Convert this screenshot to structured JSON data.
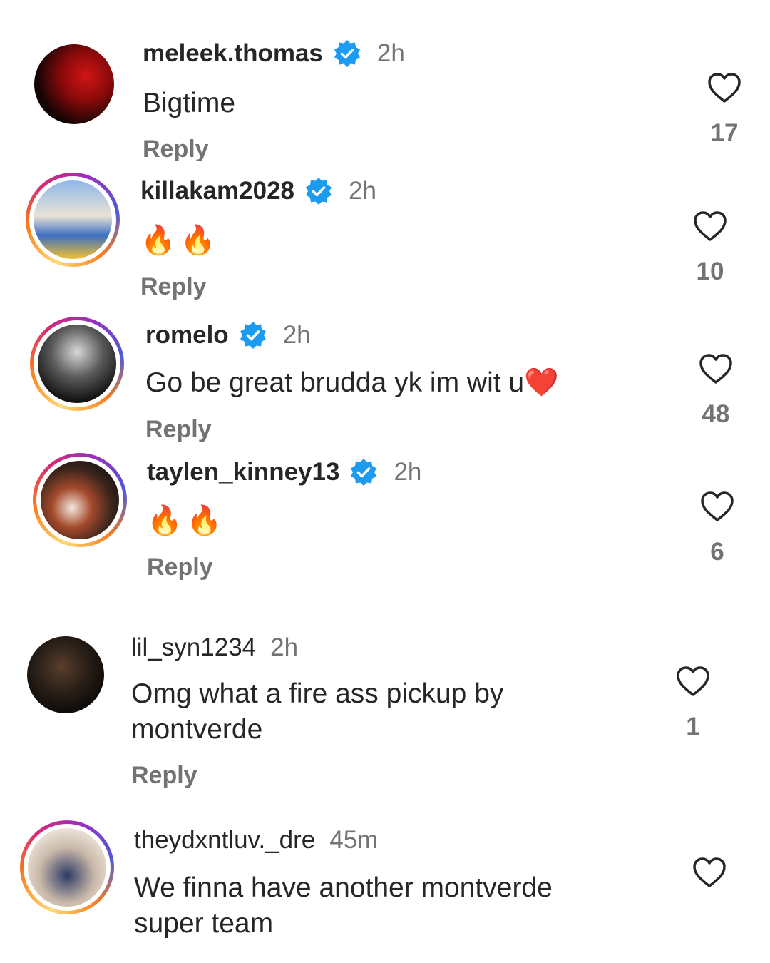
{
  "comments": [
    {
      "username": "meleek.thomas",
      "verified": true,
      "time": "2h",
      "text": "Bigtime",
      "reply": "Reply",
      "likes": "17"
    },
    {
      "username": "killakam2028",
      "verified": true,
      "time": "2h",
      "text": "🔥🔥",
      "reply": "Reply",
      "likes": "10"
    },
    {
      "username": "romelo",
      "verified": true,
      "time": "2h",
      "text": "Go be great brudda yk im wit u",
      "text_emoji": "❤️",
      "reply": "Reply",
      "likes": "48"
    },
    {
      "username": "taylen_kinney13",
      "verified": true,
      "time": "2h",
      "text": "🔥🔥",
      "reply": "Reply",
      "likes": "6"
    },
    {
      "username": "lil_syn1234",
      "verified": false,
      "time": "2h",
      "text": "Omg what a fire ass pickup by montverde",
      "reply": "Reply",
      "likes": "1"
    },
    {
      "username": "theydxntluv._dre",
      "verified": false,
      "time": "45m",
      "text": "We finna have another montverde super team",
      "reply": "",
      "likes": ""
    }
  ],
  "colors": {
    "verified_badge": "#1d9bf0",
    "username": "#262626",
    "secondary": "#737373"
  },
  "icons": {
    "verified": "verified-badge-icon",
    "like": "heart-outline-icon"
  }
}
